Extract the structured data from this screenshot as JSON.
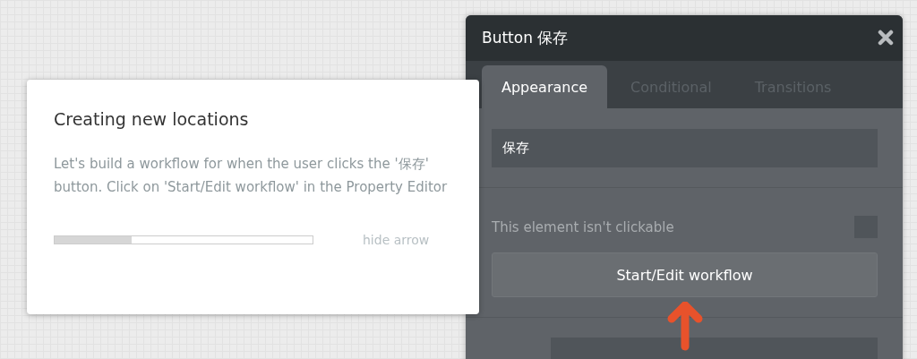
{
  "property_editor": {
    "title": "Button 保存",
    "tabs": [
      {
        "label": "Appearance",
        "selected": true
      },
      {
        "label": "Conditional",
        "selected": false
      },
      {
        "label": "Transitions",
        "selected": false
      }
    ],
    "text_field": {
      "value": "保存"
    },
    "clickable_row": {
      "label": "This element isn't clickable",
      "checked": false
    },
    "workflow_button": {
      "label": "Start/Edit workflow"
    }
  },
  "tutorial": {
    "title": "Creating new locations",
    "body": "Let's build a workflow for when the user clicks the '保存' button. Click on 'Start/Edit workflow' in the Property Editor",
    "progress": {
      "level": 0.3
    },
    "hide_link": "hide arrow"
  }
}
